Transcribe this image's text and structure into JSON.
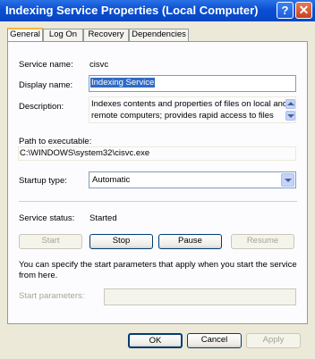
{
  "window": {
    "title": "Indexing Service Properties (Local Computer)"
  },
  "title_buttons": {
    "help": "?",
    "close": "✕"
  },
  "tabs": [
    "General",
    "Log On",
    "Recovery",
    "Dependencies"
  ],
  "general": {
    "service_name_label": "Service name:",
    "service_name": "cisvc",
    "display_name_label": "Display name:",
    "display_name": "Indexing Service",
    "description_label": "Description:",
    "description_line1": "Indexes contents and properties of files on local and",
    "description_line2": "remote computers; provides rapid access to files",
    "path_label": "Path to executable:",
    "path": "C:\\WINDOWS\\system32\\cisvc.exe",
    "startup_label": "Startup type:",
    "startup_value": "Automatic",
    "status_label": "Service status:",
    "status_value": "Started",
    "start_button": "Start",
    "stop_button": "Stop",
    "pause_button": "Pause",
    "resume_button": "Resume",
    "info_line1": "You can specify the start parameters that apply when you start the service",
    "info_line2": "from here.",
    "params_label": "Start parameters:",
    "params_value": ""
  },
  "footer": {
    "ok": "OK",
    "cancel": "Cancel",
    "apply": "Apply"
  },
  "colors": {
    "title_bar": "#0a4fd3",
    "dialog_bg": "#ece9d8",
    "selection": "#316ac5"
  }
}
